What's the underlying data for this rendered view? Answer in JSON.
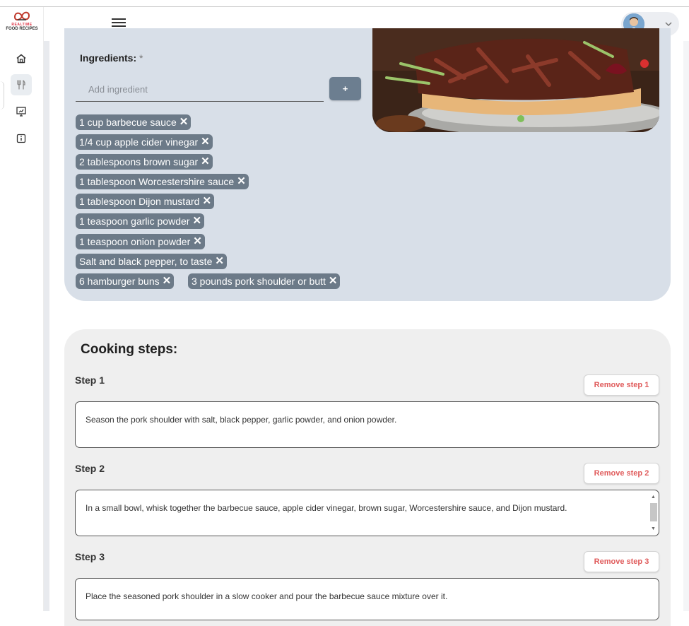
{
  "brand": {
    "line1": "REALTIME",
    "line2": "FOOD RECIPES"
  },
  "sidebar": {
    "items": [
      {
        "icon": "home-icon"
      },
      {
        "icon": "utensils-icon"
      },
      {
        "icon": "presentation-icon"
      },
      {
        "icon": "info-icon"
      }
    ]
  },
  "header": {
    "menu_icon": "hamburger-icon",
    "dropdown_icon": "chevron-down-icon"
  },
  "ingredients": {
    "label": "Ingredients:",
    "required_mark": "*",
    "input_placeholder": "Add ingredient",
    "add_button_label": "+",
    "items": [
      "1 cup barbecue sauce",
      "1/4 cup apple cider vinegar",
      "2 tablespoons brown sugar",
      "1 tablespoon Worcestershire sauce",
      "1 tablespoon Dijon mustard",
      "1 teaspoon garlic powder",
      "1 teaspoon onion powder",
      "Salt and black pepper, to taste",
      "6 hamburger buns",
      "3 pounds pork shoulder or butt"
    ]
  },
  "steps": {
    "title": "Cooking steps:",
    "items": [
      {
        "label": "Step 1",
        "remove_label": "Remove step 1",
        "text": "Season the pork shoulder with salt, black pepper, garlic powder, and onion powder."
      },
      {
        "label": "Step 2",
        "remove_label": "Remove step 2",
        "text": "In a small bowl, whisk together the barbecue sauce, apple cider vinegar, brown sugar, Worcestershire sauce, and Dijon mustard."
      },
      {
        "label": "Step 3",
        "remove_label": "Remove step 3",
        "text": "Place the seasoned pork shoulder in a slow cooker and pour the barbecue sauce mixture over it."
      }
    ]
  },
  "colors": {
    "chip": "#6c7a88",
    "ingredient_card": "#d8dfe8",
    "steps_card": "#efefef",
    "remove_text": "#e05c5c"
  }
}
